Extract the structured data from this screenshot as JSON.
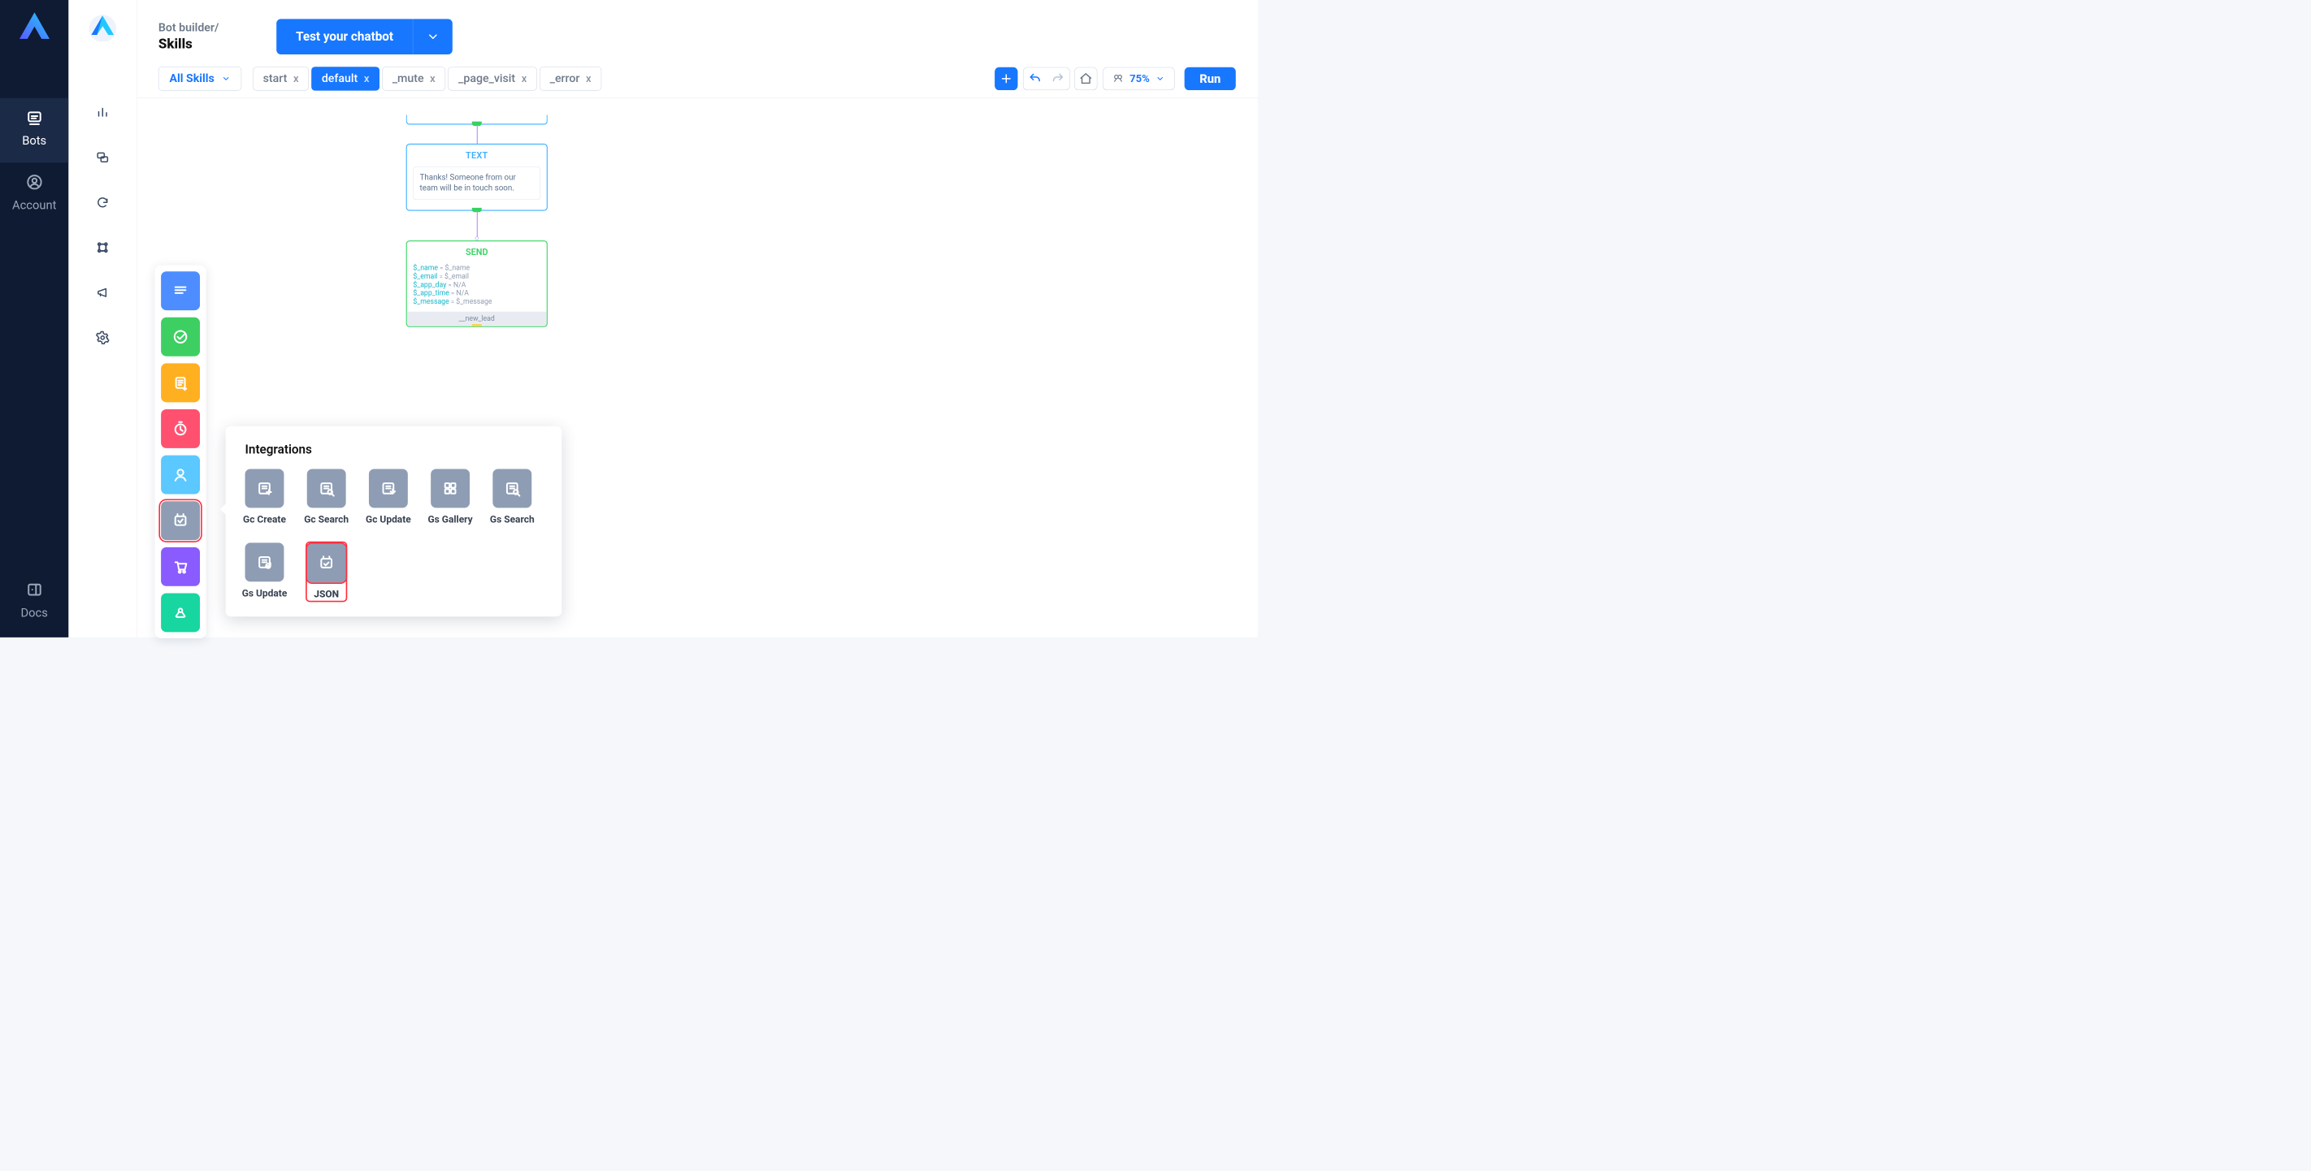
{
  "leftRail": {
    "bots": "Bots",
    "account": "Account",
    "docs": "Docs"
  },
  "header": {
    "breadcrumb": "Bot builder/",
    "title": "Skills",
    "cta": "Test your chatbot"
  },
  "toolbar": {
    "skillsSelect": "All Skills",
    "tabs": [
      {
        "label": "start",
        "active": false
      },
      {
        "label": "default",
        "active": true
      },
      {
        "label": "_mute",
        "active": false
      },
      {
        "label": "_page_visit",
        "active": false
      },
      {
        "label": "_error",
        "active": false
      }
    ],
    "zoom": "75%",
    "run": "Run"
  },
  "canvas": {
    "textNode": {
      "title": "TEXT",
      "body": "Thanks! Someone from our team will be in touch soon."
    },
    "sendNode": {
      "title": "SEND",
      "rows": [
        {
          "k": "$_name",
          "v": "$_name"
        },
        {
          "k": "$_email",
          "v": "$_email"
        },
        {
          "k": "$_app_day",
          "v": "N/A"
        },
        {
          "k": "$_app_time",
          "v": "N/A"
        },
        {
          "k": "$_message",
          "v": "$_message"
        }
      ],
      "footer": "__new_lead"
    }
  },
  "palette": {
    "items": [
      {
        "name": "text-block-tool",
        "color": "c-blue"
      },
      {
        "name": "check-tool",
        "color": "c-green"
      },
      {
        "name": "list-tool",
        "color": "c-orange"
      },
      {
        "name": "timer-tool",
        "color": "c-pink"
      },
      {
        "name": "user-tool",
        "color": "c-sky"
      },
      {
        "name": "integrations-tool",
        "color": "c-grey",
        "selected": true
      },
      {
        "name": "cart-tool",
        "color": "c-purple"
      },
      {
        "name": "webhook-tool",
        "color": "c-teal"
      }
    ]
  },
  "popover": {
    "title": "Integrations",
    "items": [
      {
        "label": "Gc Create",
        "highlight": false,
        "name": "gc-create"
      },
      {
        "label": "Gc Search",
        "highlight": false,
        "name": "gc-search"
      },
      {
        "label": "Gc Update",
        "highlight": false,
        "name": "gc-update"
      },
      {
        "label": "Gs Gallery",
        "highlight": false,
        "name": "gs-gallery"
      },
      {
        "label": "Gs Search",
        "highlight": false,
        "name": "gs-search"
      },
      {
        "label": "Gs Update",
        "highlight": false,
        "name": "gs-update"
      },
      {
        "label": "JSON",
        "highlight": true,
        "name": "json"
      }
    ]
  }
}
